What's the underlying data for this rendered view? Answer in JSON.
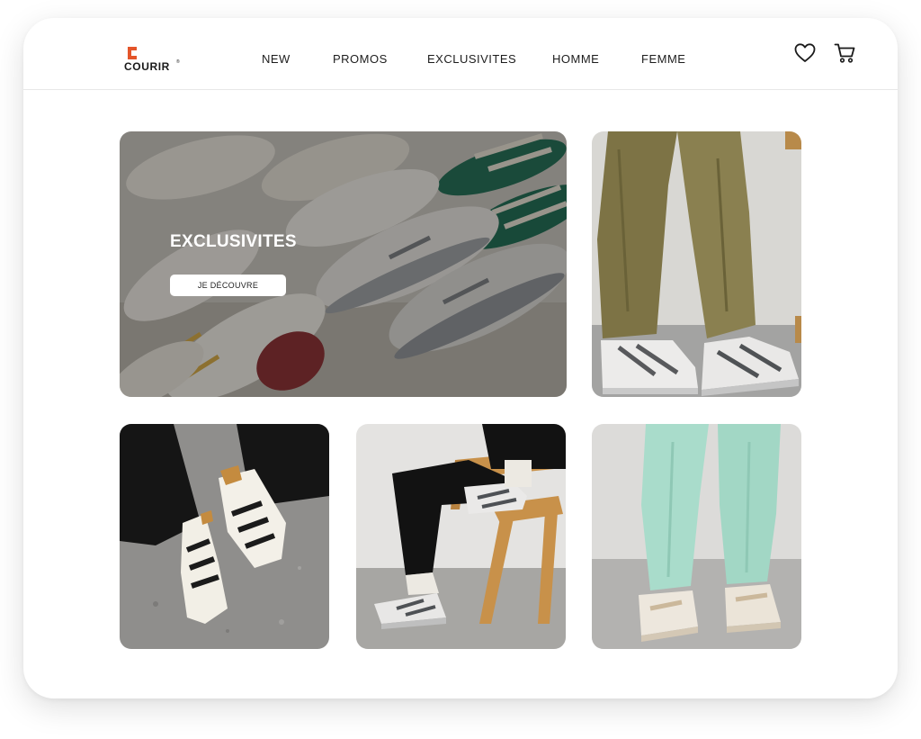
{
  "brand": {
    "name": "COURIR",
    "trademark": "®",
    "accent_color": "#e4552a"
  },
  "nav": {
    "items": [
      {
        "label": "NEW"
      },
      {
        "label": "PROMOS"
      },
      {
        "label": "EXCLUSIVITES"
      },
      {
        "label": "HOMME"
      },
      {
        "label": "FEMME"
      }
    ]
  },
  "header_icons": {
    "wishlist": "heart-icon",
    "cart": "cart-icon"
  },
  "hero": {
    "title": "EXCLUSIVITES",
    "button_label": "JE DÉCOUVRE"
  },
  "tiles": [
    {
      "name": "olive-pants-sneakers"
    },
    {
      "name": "black-pants-superstar"
    },
    {
      "name": "chair-seated-sneakers"
    },
    {
      "name": "mint-joggers-sneakers"
    }
  ]
}
